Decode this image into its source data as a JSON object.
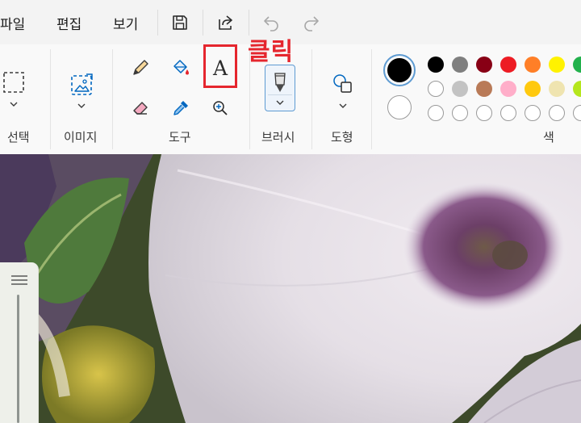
{
  "menu": {
    "file": "파일",
    "edit": "편집",
    "view": "보기"
  },
  "quick_icons": [
    "save-icon",
    "share-icon",
    "undo-icon",
    "redo-icon"
  ],
  "ribbon": {
    "groups": {
      "select": "선택",
      "image": "이미지",
      "tools": "도구",
      "brush": "브러시",
      "shapes": "도형",
      "colors": "색"
    },
    "tool_icons": [
      "pencil-icon",
      "fill-bucket-icon",
      "text-icon",
      "eraser-icon",
      "color-picker-icon",
      "magnifier-icon"
    ],
    "text_tool_glyph": "A",
    "selected_color": "#000000",
    "secondary_color": "#ffffff",
    "palette_row1": [
      "#000000",
      "#7f7f7f",
      "#880015",
      "#ed1c24",
      "#ff7f27",
      "#fff200",
      "#22b14c"
    ],
    "palette_row2": [
      "#ffffff",
      "#c3c3c3",
      "#b97a57",
      "#ffaec9",
      "#ffc90e",
      "#efe4b0",
      "#b5e61d"
    ],
    "palette_row3": [
      "empty",
      "empty",
      "empty",
      "empty",
      "empty",
      "empty",
      "empty"
    ]
  },
  "annotation": {
    "label": "클릭",
    "color": "#e5262e"
  }
}
